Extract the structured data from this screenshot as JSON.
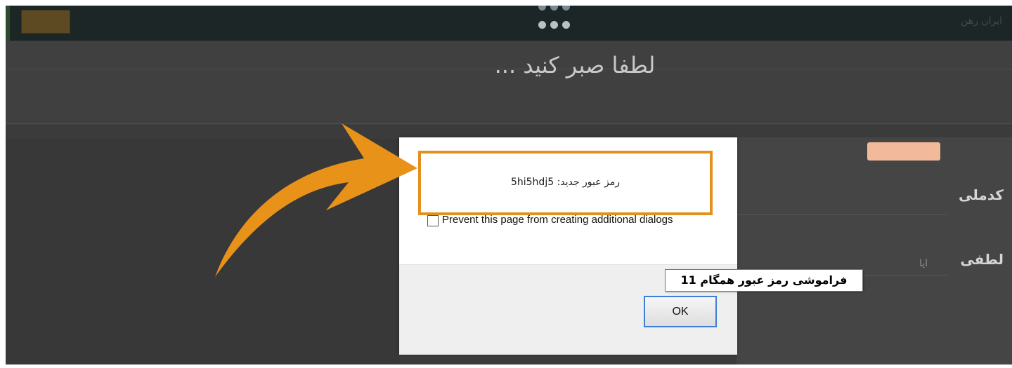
{
  "app": {
    "brand": "ایران رهن"
  },
  "header": {
    "loading_text": "لطفا صبر کنید ..."
  },
  "background_form": {
    "field1_label": "کدملی",
    "field2_label": "لطفی",
    "field2_hint": "ایا"
  },
  "dialog": {
    "message": "رمز عبور جدید: 5hi5hdj5",
    "prevent_label": "Prevent this page from creating additional dialogs",
    "ok_label": "OK"
  },
  "tooltip": {
    "text": "فراموشی رمز عبور همگام 11"
  },
  "colors": {
    "highlight_border": "#e2901f",
    "arrow": "#e8921a",
    "ok_focus": "#3c7fd4",
    "topbar": "#1c2626"
  },
  "icons": {
    "arrow": "curved-arrow-icon",
    "loading": "loading-dots-icon"
  }
}
